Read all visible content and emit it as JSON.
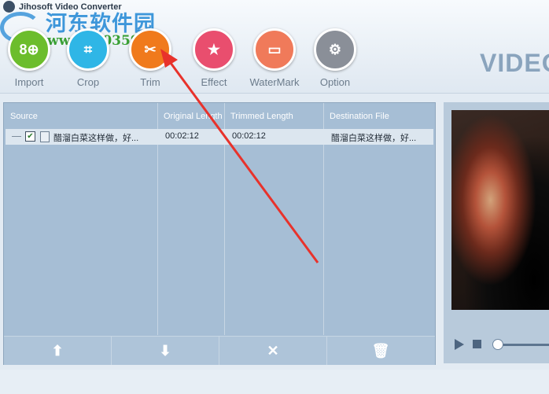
{
  "app": {
    "title": "Jihosoft Video Converter",
    "brand": "VIDEO"
  },
  "watermark": {
    "text": "河东软件园",
    "url": "www.pc0359.cn"
  },
  "toolbar": {
    "buttons": [
      {
        "label": "Import",
        "icon": "film-plus-icon",
        "color": "#6cbd2c"
      },
      {
        "label": "Crop",
        "icon": "crop-icon",
        "color": "#2fb6e6"
      },
      {
        "label": "Trim",
        "icon": "scissors-icon",
        "color": "#f07a1c"
      },
      {
        "label": "Effect",
        "icon": "monitor-star-icon",
        "color": "#e94e6e"
      },
      {
        "label": "WaterMark",
        "icon": "watermark-icon",
        "color": "#f07a5a"
      },
      {
        "label": "Option",
        "icon": "gear-icon",
        "color": "#8a8f98"
      }
    ]
  },
  "file_list": {
    "columns": [
      "Source",
      "Original Length",
      "Trimmed Length",
      "Destination File"
    ],
    "rows": [
      {
        "source": "醋溜白菜这样做，好...",
        "original": "00:02:12",
        "trimmed": "00:02:12",
        "destination": "醋溜白菜这样做，好...",
        "checked": true
      }
    ]
  },
  "list_actions": [
    {
      "name": "move-up",
      "glyph": "⬆"
    },
    {
      "name": "move-down",
      "glyph": "⬇"
    },
    {
      "name": "remove",
      "glyph": "✕"
    },
    {
      "name": "clear",
      "glyph": "🗑"
    }
  ],
  "preview": {
    "playing": false,
    "position": 0.0
  }
}
